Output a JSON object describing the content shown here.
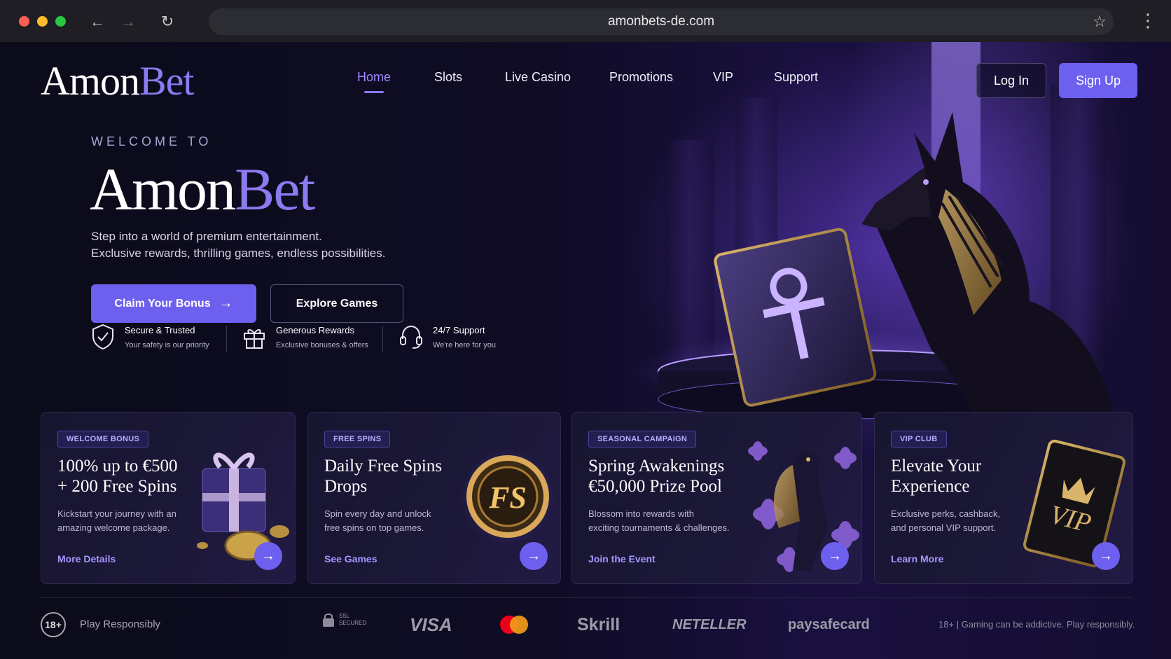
{
  "browser": {
    "url": "amonbets-de.com"
  },
  "brand": {
    "part1": "Amon",
    "part2": "Bet"
  },
  "nav": {
    "items": [
      "Home",
      "Slots",
      "Live Casino",
      "Promotions",
      "VIP",
      "Support"
    ],
    "active": "Home",
    "login": "Log In",
    "signup": "Sign Up"
  },
  "hero": {
    "eyebrow": "WELCOME TO",
    "title1": "Amon",
    "title2": "Bet",
    "line1": "Step into a world of premium entertainment.",
    "line2": "Exclusive rewards, thrilling games, endless possibilities.",
    "cta_primary": "Claim Your Bonus",
    "cta_secondary": "Explore Games"
  },
  "features": [
    {
      "title": "Secure & Trusted",
      "sub": "Your safety is our priority",
      "icon": "shield-check-icon"
    },
    {
      "title": "Generous Rewards",
      "sub": "Exclusive bonuses & offers",
      "icon": "gift-icon"
    },
    {
      "title": "24/7 Support",
      "sub": "We're here for you",
      "icon": "headset-icon"
    }
  ],
  "cards": [
    {
      "badge": "WELCOME BONUS",
      "title1": "100% up to €500",
      "title2": "+ 200 Free Spins",
      "desc1": "Kickstart your journey with an",
      "desc2": "amazing welcome package.",
      "link": "More Details"
    },
    {
      "badge": "FREE SPINS",
      "title1": "Daily Free Spins",
      "title2": "Drops",
      "desc1": "Spin every day and unlock",
      "desc2": "free spins on top games.",
      "link": "See Games",
      "coin": "FS"
    },
    {
      "badge": "SEASONAL CAMPAIGN",
      "title1": "Spring Awakenings",
      "title2": "€50,000 Prize Pool",
      "desc1": "Blossom into rewards with",
      "desc2": "exciting tournaments & challenges.",
      "link": "Join the Event"
    },
    {
      "badge": "VIP CLUB",
      "title1": "Elevate Your",
      "title2": "Experience",
      "desc1": "Exclusive perks, cashback,",
      "desc2": "and personal VIP support.",
      "link": "Learn More",
      "card_text": "VIP"
    }
  ],
  "footer": {
    "age": "18+",
    "responsible": "Play Responsibly",
    "ssl1": "SSL",
    "ssl2": "SECURED",
    "payments": [
      "VISA",
      "Skrill",
      "NETELLER",
      "paysafecard"
    ],
    "disclaimer": "18+ | Gaming can be addictive. Play responsibly."
  }
}
